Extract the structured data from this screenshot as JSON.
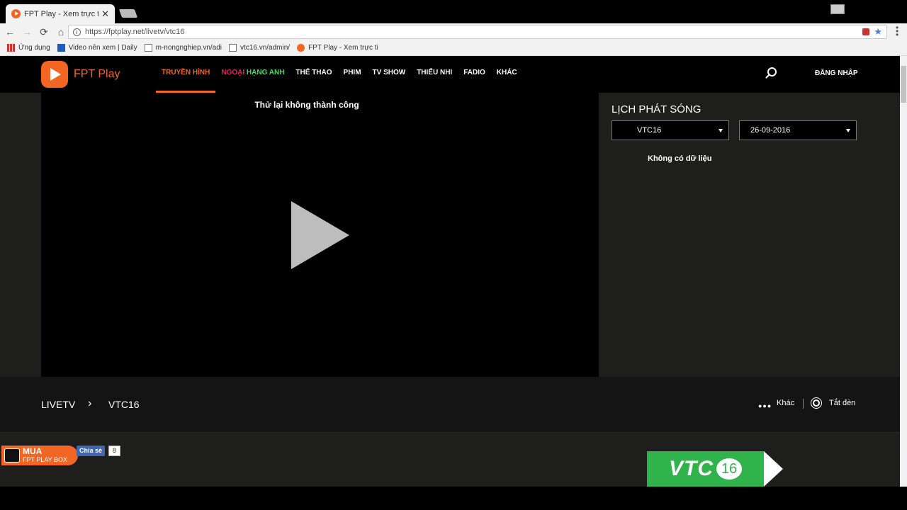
{
  "browser": {
    "tab_title": "FPT Play - Xem trực tiếp",
    "tab_close": "✕",
    "url": "https://fptplay.net/livetv/vtc16",
    "bookmarks": [
      {
        "label": "Ứng dụng",
        "icon": "apps-icon"
      },
      {
        "label": "Video nên xem | Daily",
        "icon": "video-icon"
      },
      {
        "label": "m-nongnghiep.vn/adi",
        "icon": "doc-icon"
      },
      {
        "label": "vtc16.vn/admin/",
        "icon": "doc-icon"
      },
      {
        "label": "FPT Play - Xem trực ti",
        "icon": "fpt-icon"
      }
    ]
  },
  "header": {
    "logo_text": "FPT Play",
    "nav": [
      {
        "label": "TRUYỀN HÌNH",
        "active": true
      },
      {
        "label_part1": "NGOẠI ",
        "label_part2": "HẠNG ANH"
      },
      {
        "label": "THỂ THAO"
      },
      {
        "label": "PHIM"
      },
      {
        "label": "TV SHOW"
      },
      {
        "label": "THIẾU NHI"
      },
      {
        "label": "FADIO"
      },
      {
        "label": "KHÁC"
      }
    ],
    "login_label": "ĐĂNG NHẬP"
  },
  "player": {
    "status_text": "Thử lại không thành công"
  },
  "schedule": {
    "title": "LỊCH PHÁT SÓNG",
    "channel_value": "VTC16",
    "date_value": "26-09-2016",
    "empty_text": "Không có dữ liệu"
  },
  "breadcrumb": {
    "root": "LIVETV",
    "separator": "›",
    "current": "VTC16",
    "more_label": "Khác",
    "light_label": "Tắt đèn"
  },
  "footer": {
    "mua_title": "MUA",
    "mua_subtitle": "FPT PLAY BOX",
    "share_label": "Chia sẻ",
    "share_count": "8",
    "vtc_text": "VTC",
    "vtc_number": "16"
  },
  "colors": {
    "accent": "#f26522",
    "dark_panel": "#1e1f1d",
    "vtc_green": "#2fb34a"
  }
}
